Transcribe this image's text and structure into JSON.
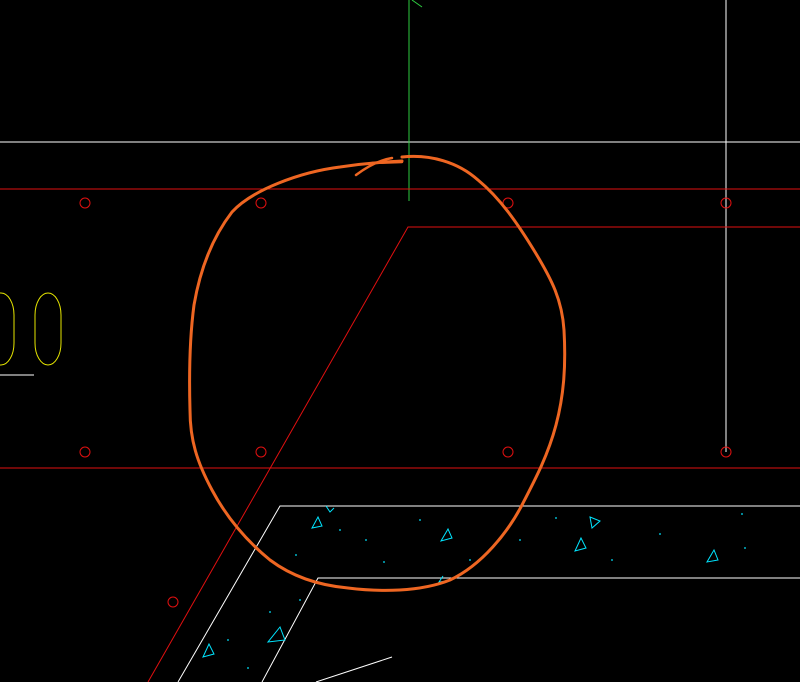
{
  "drawing": {
    "background": "#000000",
    "colors": {
      "white": "#ffffff",
      "red": "#e01010",
      "green": "#2ecc40",
      "yellow": "#e6e600",
      "cyan": "#00e5ff",
      "markup": "#ee6622"
    },
    "layers": {
      "grid_lines": "white",
      "beam_lines": "red",
      "axis_line": "green",
      "slab_edge": "white",
      "concrete_hatch": "cyan",
      "markup_cloud": "markup",
      "column_marks": "yellow"
    }
  }
}
